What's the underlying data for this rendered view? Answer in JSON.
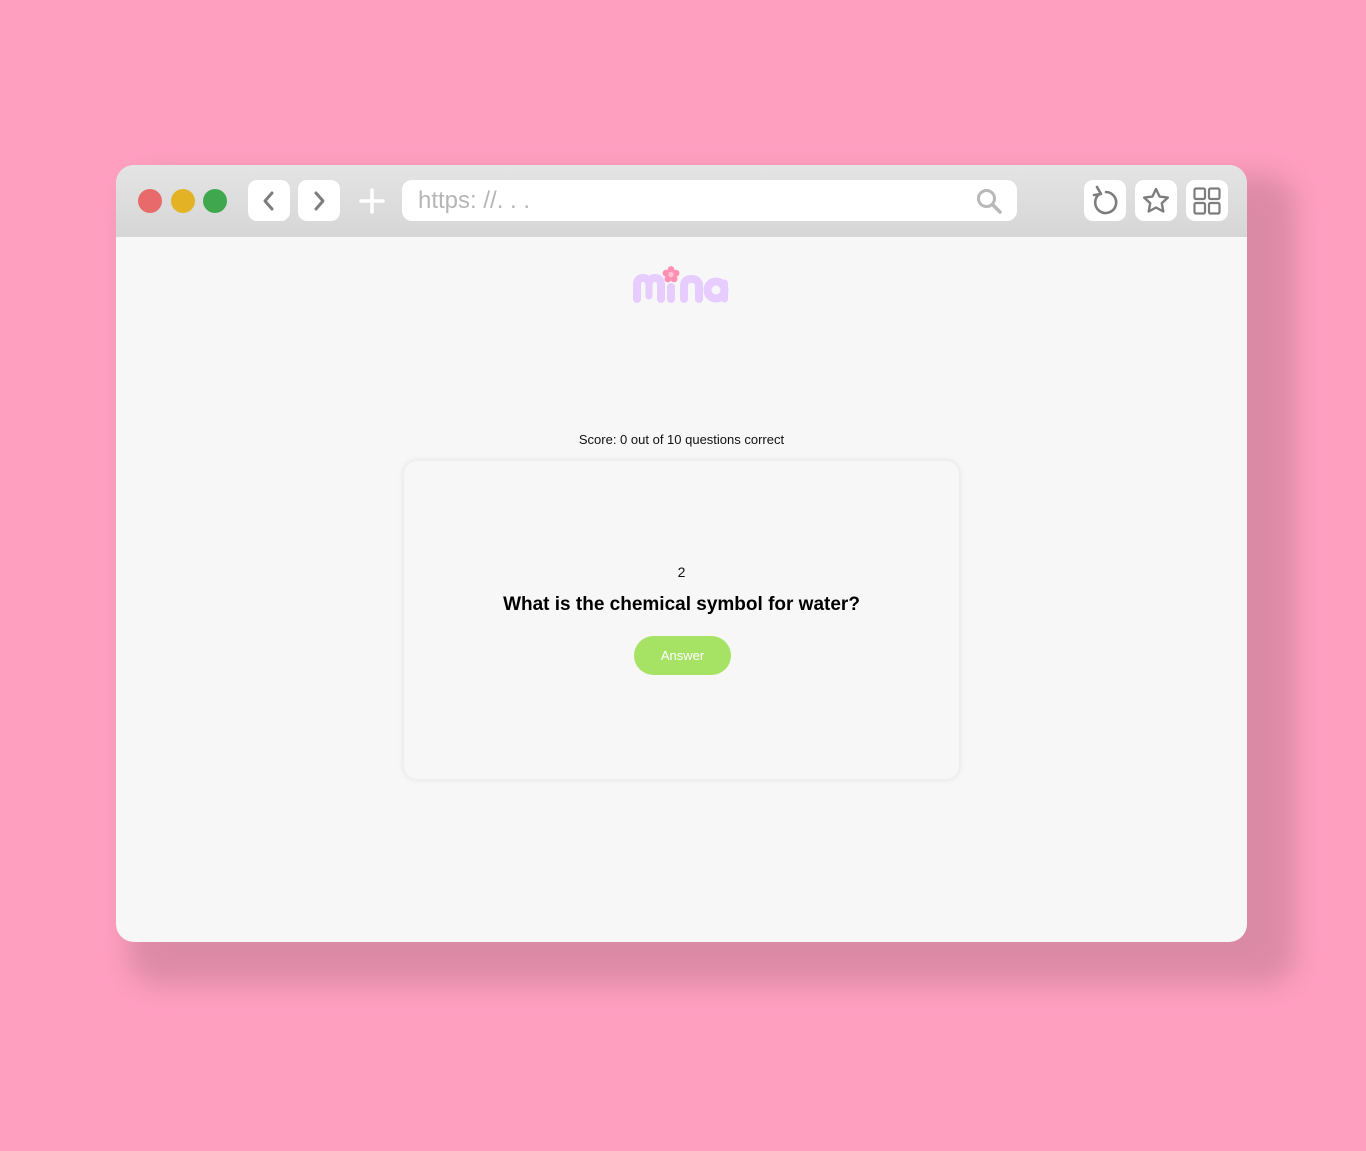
{
  "browser": {
    "traffic_lights": [
      {
        "name": "close",
        "color": "#e96a6a"
      },
      {
        "name": "minimize",
        "color": "#e3b325"
      },
      {
        "name": "maximize",
        "color": "#3fa84f"
      }
    ],
    "icons": {
      "back": "chevron-left-icon",
      "forward": "chevron-right-icon",
      "new_tab": "plus-icon",
      "search": "search-icon",
      "reload": "reload-icon",
      "bookmark": "star-icon",
      "tabs_overview": "grid-icon"
    },
    "url_placeholder": "https: //. . ."
  },
  "site": {
    "logo_text": "mina",
    "logo_colors": {
      "letters": "#e6ccff",
      "flower": "#ff8fb3"
    }
  },
  "quiz": {
    "score_text": "Score: 0 out of 10 questions correct",
    "question_number": "2",
    "question_text": "What is the chemical symbol for water?",
    "answer_button_label": "Answer",
    "answer_button_color": "#a6e364"
  },
  "colors": {
    "background": "#ff9fc0",
    "window": "#f7f7f7",
    "toolbar": "#dcdcdc"
  }
}
